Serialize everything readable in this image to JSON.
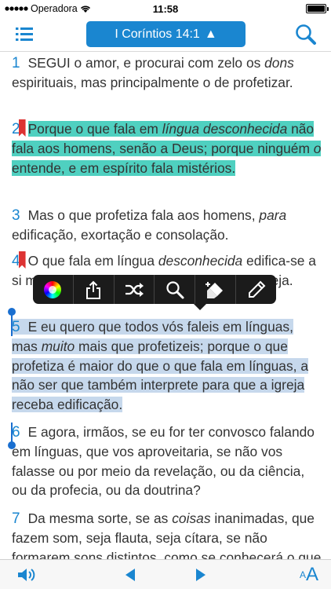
{
  "status_bar": {
    "carrier": "Operadora",
    "time": "11:58"
  },
  "nav": {
    "reference": "I Coríntios 14:1",
    "reference_arrow": "▲"
  },
  "verses": [
    {
      "num": "1",
      "t1": "SEGUI o amor, e procurai com zelo os ",
      "t2": "dons",
      "t3": " espirituais, mas principalmente o de profetizar."
    },
    {
      "num": "2",
      "t1": "Porque o que fala em ",
      "t2": "língua desconhecida",
      "t3": " não fala aos homens, senão a Deus; porque ninguém ",
      "t4": "o",
      "t5": " entende, e em espírito fala mistérios."
    },
    {
      "num": "3",
      "t1": "Mas o que profetiza fala aos homens, ",
      "t2": "para",
      "t3": " edificação, exortação e consolação."
    },
    {
      "num": "4",
      "t1": "O que fala em língua ",
      "t2": "desconhecida",
      "t3": " edifica-se a si mesmo, mas o que profetiza edifica a igreja."
    },
    {
      "num": "5",
      "t1": "E eu quero que todos vós faleis em línguas, mas ",
      "t2": "muito",
      "t3": " mais que profetizeis; porque o que profetiza é maior do que o que fala em línguas, a não ser que também interprete para que a igreja receba edificação."
    },
    {
      "num": "6",
      "t1": "E agora, irmãos, se eu for ter convosco falando em línguas, que vos aproveitaria, se não vos falasse ou por meio da revelação, ou da ciência, ou da profecia, ou da doutrina?"
    },
    {
      "num": "7",
      "t1": "Da mesma sorte, se as ",
      "t2": "coisas",
      "t3": " inanimadas, que fazem som, seja flauta, seja cítara, se não formarem sons distintos, como se conhecerá o que se toca com a flauta ou com a cítara?"
    }
  ],
  "toolbar": {
    "tools": [
      "color-wheel-icon",
      "share-icon",
      "shuffle-icon",
      "search-icon",
      "highlighter-icon",
      "pencil-icon"
    ]
  },
  "bottom_bar": {
    "font_small": "A",
    "font_large": "A"
  },
  "colors": {
    "accent": "#1a86d0",
    "highlight_teal": "#4fd0c0",
    "highlight_selection": "#c6d8ec",
    "bookmark": "#dd3333"
  }
}
